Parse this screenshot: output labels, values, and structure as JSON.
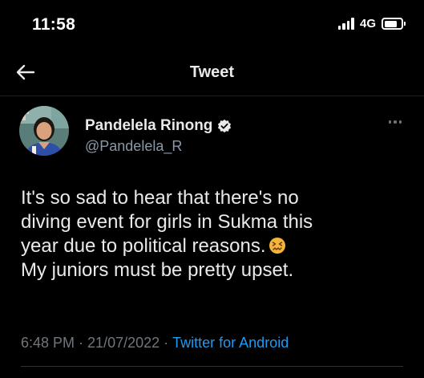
{
  "status_bar": {
    "time": "11:58",
    "network": "4G"
  },
  "header": {
    "title": "Tweet",
    "back_icon": "arrow-left-icon"
  },
  "tweet": {
    "author_name": "Pandelela Rinong",
    "handle": "@Pandelela_R",
    "verified": true,
    "body_lines": [
      "It's so sad to hear that there's no",
      "diving event for girls in Sukma this",
      "year due to political reasons.",
      "My juniors must be pretty upset."
    ],
    "emoji": "confounded-face-emoji",
    "time": "6:48 PM",
    "separator": "·",
    "date": "21/07/2022",
    "source": "Twitter for Android"
  },
  "colors": {
    "background": "#000000",
    "text": "#e7e9ea",
    "secondary": "#8b98a5",
    "accent": "#1d9bf0"
  }
}
